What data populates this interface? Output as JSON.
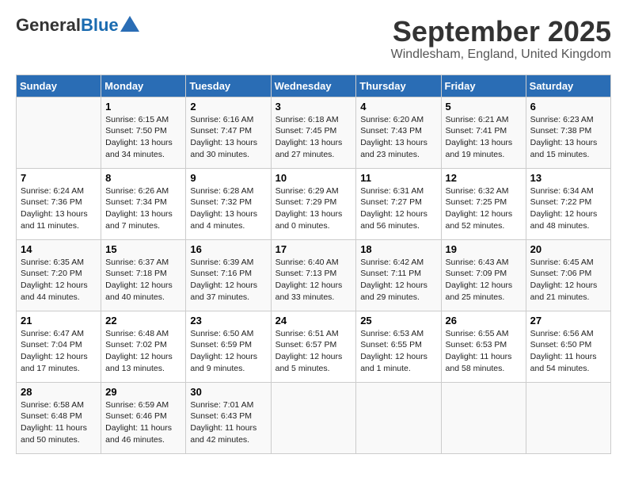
{
  "header": {
    "logo_line1": "General",
    "logo_line2": "Blue",
    "month_title": "September 2025",
    "location": "Windlesham, England, United Kingdom"
  },
  "days_of_week": [
    "Sunday",
    "Monday",
    "Tuesday",
    "Wednesday",
    "Thursday",
    "Friday",
    "Saturday"
  ],
  "weeks": [
    [
      {
        "day": "",
        "sunrise": "",
        "sunset": "",
        "daylight": ""
      },
      {
        "day": "1",
        "sunrise": "Sunrise: 6:15 AM",
        "sunset": "Sunset: 7:50 PM",
        "daylight": "Daylight: 13 hours and 34 minutes."
      },
      {
        "day": "2",
        "sunrise": "Sunrise: 6:16 AM",
        "sunset": "Sunset: 7:47 PM",
        "daylight": "Daylight: 13 hours and 30 minutes."
      },
      {
        "day": "3",
        "sunrise": "Sunrise: 6:18 AM",
        "sunset": "Sunset: 7:45 PM",
        "daylight": "Daylight: 13 hours and 27 minutes."
      },
      {
        "day": "4",
        "sunrise": "Sunrise: 6:20 AM",
        "sunset": "Sunset: 7:43 PM",
        "daylight": "Daylight: 13 hours and 23 minutes."
      },
      {
        "day": "5",
        "sunrise": "Sunrise: 6:21 AM",
        "sunset": "Sunset: 7:41 PM",
        "daylight": "Daylight: 13 hours and 19 minutes."
      },
      {
        "day": "6",
        "sunrise": "Sunrise: 6:23 AM",
        "sunset": "Sunset: 7:38 PM",
        "daylight": "Daylight: 13 hours and 15 minutes."
      }
    ],
    [
      {
        "day": "7",
        "sunrise": "Sunrise: 6:24 AM",
        "sunset": "Sunset: 7:36 PM",
        "daylight": "Daylight: 13 hours and 11 minutes."
      },
      {
        "day": "8",
        "sunrise": "Sunrise: 6:26 AM",
        "sunset": "Sunset: 7:34 PM",
        "daylight": "Daylight: 13 hours and 7 minutes."
      },
      {
        "day": "9",
        "sunrise": "Sunrise: 6:28 AM",
        "sunset": "Sunset: 7:32 PM",
        "daylight": "Daylight: 13 hours and 4 minutes."
      },
      {
        "day": "10",
        "sunrise": "Sunrise: 6:29 AM",
        "sunset": "Sunset: 7:29 PM",
        "daylight": "Daylight: 13 hours and 0 minutes."
      },
      {
        "day": "11",
        "sunrise": "Sunrise: 6:31 AM",
        "sunset": "Sunset: 7:27 PM",
        "daylight": "Daylight: 12 hours and 56 minutes."
      },
      {
        "day": "12",
        "sunrise": "Sunrise: 6:32 AM",
        "sunset": "Sunset: 7:25 PM",
        "daylight": "Daylight: 12 hours and 52 minutes."
      },
      {
        "day": "13",
        "sunrise": "Sunrise: 6:34 AM",
        "sunset": "Sunset: 7:22 PM",
        "daylight": "Daylight: 12 hours and 48 minutes."
      }
    ],
    [
      {
        "day": "14",
        "sunrise": "Sunrise: 6:35 AM",
        "sunset": "Sunset: 7:20 PM",
        "daylight": "Daylight: 12 hours and 44 minutes."
      },
      {
        "day": "15",
        "sunrise": "Sunrise: 6:37 AM",
        "sunset": "Sunset: 7:18 PM",
        "daylight": "Daylight: 12 hours and 40 minutes."
      },
      {
        "day": "16",
        "sunrise": "Sunrise: 6:39 AM",
        "sunset": "Sunset: 7:16 PM",
        "daylight": "Daylight: 12 hours and 37 minutes."
      },
      {
        "day": "17",
        "sunrise": "Sunrise: 6:40 AM",
        "sunset": "Sunset: 7:13 PM",
        "daylight": "Daylight: 12 hours and 33 minutes."
      },
      {
        "day": "18",
        "sunrise": "Sunrise: 6:42 AM",
        "sunset": "Sunset: 7:11 PM",
        "daylight": "Daylight: 12 hours and 29 minutes."
      },
      {
        "day": "19",
        "sunrise": "Sunrise: 6:43 AM",
        "sunset": "Sunset: 7:09 PM",
        "daylight": "Daylight: 12 hours and 25 minutes."
      },
      {
        "day": "20",
        "sunrise": "Sunrise: 6:45 AM",
        "sunset": "Sunset: 7:06 PM",
        "daylight": "Daylight: 12 hours and 21 minutes."
      }
    ],
    [
      {
        "day": "21",
        "sunrise": "Sunrise: 6:47 AM",
        "sunset": "Sunset: 7:04 PM",
        "daylight": "Daylight: 12 hours and 17 minutes."
      },
      {
        "day": "22",
        "sunrise": "Sunrise: 6:48 AM",
        "sunset": "Sunset: 7:02 PM",
        "daylight": "Daylight: 12 hours and 13 minutes."
      },
      {
        "day": "23",
        "sunrise": "Sunrise: 6:50 AM",
        "sunset": "Sunset: 6:59 PM",
        "daylight": "Daylight: 12 hours and 9 minutes."
      },
      {
        "day": "24",
        "sunrise": "Sunrise: 6:51 AM",
        "sunset": "Sunset: 6:57 PM",
        "daylight": "Daylight: 12 hours and 5 minutes."
      },
      {
        "day": "25",
        "sunrise": "Sunrise: 6:53 AM",
        "sunset": "Sunset: 6:55 PM",
        "daylight": "Daylight: 12 hours and 1 minute."
      },
      {
        "day": "26",
        "sunrise": "Sunrise: 6:55 AM",
        "sunset": "Sunset: 6:53 PM",
        "daylight": "Daylight: 11 hours and 58 minutes."
      },
      {
        "day": "27",
        "sunrise": "Sunrise: 6:56 AM",
        "sunset": "Sunset: 6:50 PM",
        "daylight": "Daylight: 11 hours and 54 minutes."
      }
    ],
    [
      {
        "day": "28",
        "sunrise": "Sunrise: 6:58 AM",
        "sunset": "Sunset: 6:48 PM",
        "daylight": "Daylight: 11 hours and 50 minutes."
      },
      {
        "day": "29",
        "sunrise": "Sunrise: 6:59 AM",
        "sunset": "Sunset: 6:46 PM",
        "daylight": "Daylight: 11 hours and 46 minutes."
      },
      {
        "day": "30",
        "sunrise": "Sunrise: 7:01 AM",
        "sunset": "Sunset: 6:43 PM",
        "daylight": "Daylight: 11 hours and 42 minutes."
      },
      {
        "day": "",
        "sunrise": "",
        "sunset": "",
        "daylight": ""
      },
      {
        "day": "",
        "sunrise": "",
        "sunset": "",
        "daylight": ""
      },
      {
        "day": "",
        "sunrise": "",
        "sunset": "",
        "daylight": ""
      },
      {
        "day": "",
        "sunrise": "",
        "sunset": "",
        "daylight": ""
      }
    ]
  ]
}
